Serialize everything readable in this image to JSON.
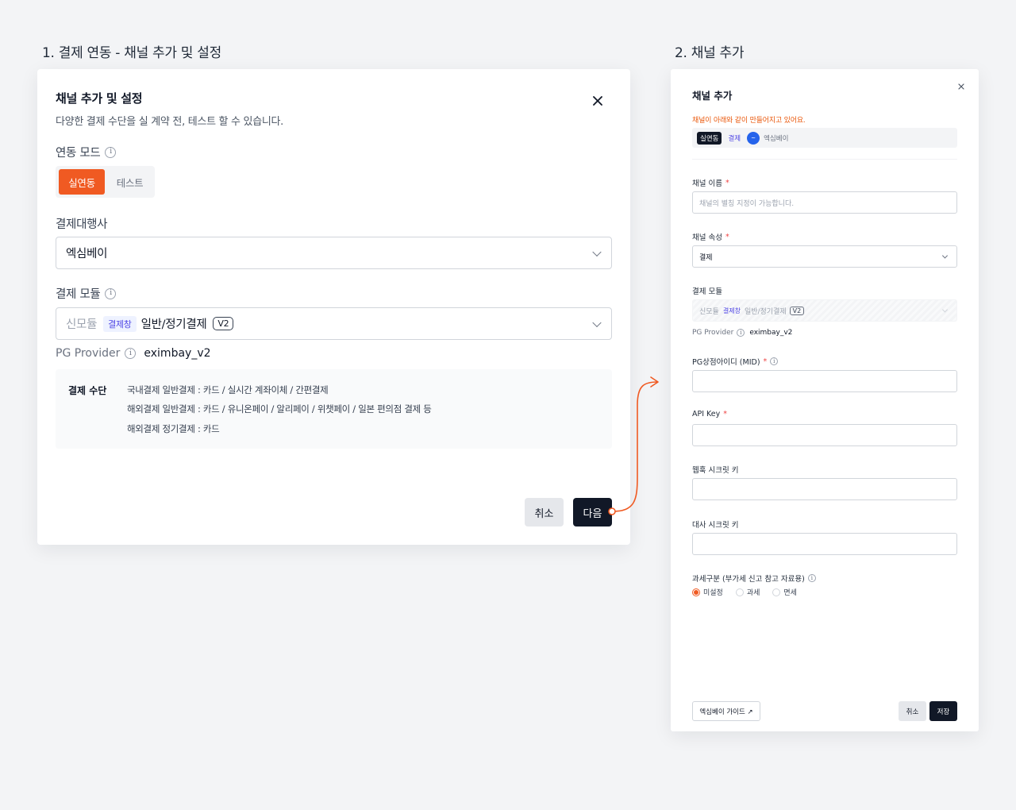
{
  "steps": {
    "step1": "1. 결제 연동 - 채널 추가 및 설정",
    "step2": "2. 채널 추가"
  },
  "left_modal": {
    "title": "채널 추가 및 설정",
    "subtitle": "다양한 결제 수단을 실 계약 전, 테스트 할 수 있습니다.",
    "mode_label": "연동 모드",
    "mode_options": [
      "실연동",
      "테스트"
    ],
    "mode_selected": "실연동",
    "pg_label": "결제대행사",
    "pg_value": "엑심베이",
    "module_label": "결제 모듈",
    "module_value": {
      "prefix": "신모듈",
      "badge": "결제창",
      "text": "일반/정기결제",
      "version": "V2"
    },
    "pg_provider_label": "PG Provider",
    "pg_provider_value": "eximbay_v2",
    "methods_label": "결제 수단",
    "methods": [
      "국내결제 일반결제 : 카드 / 실시간 계좌이체 / 간편결제",
      "해외결제 일반결제 : 카드 / 유니온페이 / 알리페이 / 위챗페이 / 일본 편의점 결제 등",
      "해외결제 정기결제 : 카드"
    ],
    "cancel_label": "취소",
    "next_label": "다음"
  },
  "right_modal": {
    "title": "채널 추가",
    "notice": "채널이 아래와 같이 만들어지고 있어요.",
    "summary": {
      "mode": "실연동",
      "type": "결제",
      "pg": "엑심베이",
      "logo_text": "~"
    },
    "channel_name_label": "채널 이름",
    "channel_name_placeholder": "채널의 별칭 지정이 가능합니다.",
    "channel_attr_label": "채널 속성",
    "channel_attr_value": "결제",
    "module_label": "결제 모듈",
    "module_value": {
      "prefix": "신모듈",
      "badge": "결제창",
      "text": "일반/정기결제",
      "version": "V2"
    },
    "pg_provider_label": "PG Provider",
    "pg_provider_value": "eximbay_v2",
    "mid_label": "PG상점아이디 (MID)",
    "api_key_label": "API Key",
    "webhook_label": "웹훅 시크릿 키",
    "settlement_label": "대사 시크릿 키",
    "tax_label": "과세구분 (부가세 신고 참고 자료용)",
    "tax_options": [
      "미설정",
      "과세",
      "면세"
    ],
    "tax_selected": "미설정",
    "guide_label": "엑심베이 가이드 ↗",
    "cancel_label": "취소",
    "save_label": "저장"
  },
  "colors": {
    "accent": "#f05a22",
    "dark": "#111827",
    "badge_blue": "#4f46e5"
  }
}
